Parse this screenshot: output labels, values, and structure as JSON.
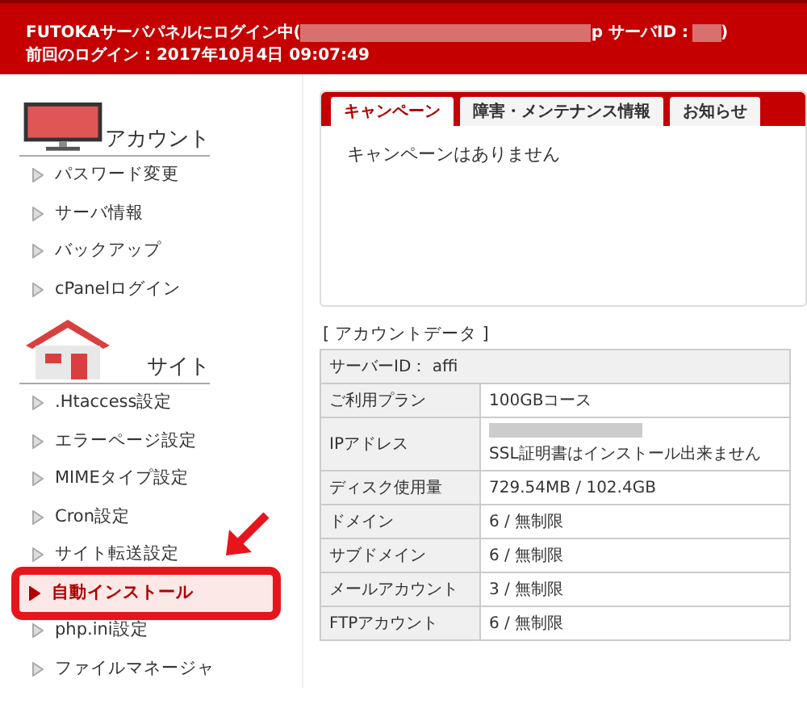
{
  "header": {
    "login_prefix": "FUTOKAサーバパネルにログイン中(",
    "login_middle": "p サーバID : ",
    "login_suffix": ")",
    "last_login": "前回のログイン : 2017年10月4日 09:07:49"
  },
  "sidebar": {
    "sections": [
      {
        "kind": "monitor",
        "title": "アカウント",
        "items": [
          {
            "label": "パスワード変更",
            "selected": false
          },
          {
            "label": "サーバ情報",
            "selected": false
          },
          {
            "label": "バックアップ",
            "selected": false
          },
          {
            "label": "cPanelログイン",
            "selected": false
          }
        ]
      },
      {
        "kind": "house",
        "title": "サイト",
        "items": [
          {
            "label": ".Htaccess設定",
            "selected": false
          },
          {
            "label": "エラーページ設定",
            "selected": false
          },
          {
            "label": "MIMEタイプ設定",
            "selected": false
          },
          {
            "label": "Cron設定",
            "selected": false
          },
          {
            "label": "サイト転送設定",
            "selected": false
          },
          {
            "label": "自動インストール",
            "selected": true
          },
          {
            "label": "php.ini設定",
            "selected": false
          },
          {
            "label": "ファイルマネージャ",
            "selected": false
          }
        ]
      }
    ]
  },
  "tabs": [
    {
      "label": "キャンペーン",
      "selected": true
    },
    {
      "label": "障害・メンテナンス情報",
      "selected": false
    },
    {
      "label": "お知らせ",
      "selected": false
    }
  ],
  "tab_content": "キャンペーンはありません",
  "account_data": {
    "title": "[ アカウントデータ ]",
    "server_id": "サーバーID： affi",
    "rows": [
      {
        "label": "ご利用プラン",
        "value": [
          "100GBコース"
        ],
        "redacted": false
      },
      {
        "label": "IPアドレス",
        "value": [
          "SSL証明書はインストール出来ません"
        ],
        "redacted": true
      },
      {
        "label": "ディスク使用量",
        "value": [
          "729.54MB / 102.4GB"
        ],
        "redacted": false
      },
      {
        "label": "ドメイン",
        "value": [
          "6 / 無制限"
        ],
        "redacted": false
      },
      {
        "label": "サブドメイン",
        "value": [
          "6 / 無制限"
        ],
        "redacted": false
      },
      {
        "label": "メールアカウント",
        "value": [
          "3 / 無制限"
        ],
        "redacted": false
      },
      {
        "label": "FTPアカウント",
        "value": [
          "6 / 無制限"
        ],
        "redacted": false
      }
    ]
  }
}
